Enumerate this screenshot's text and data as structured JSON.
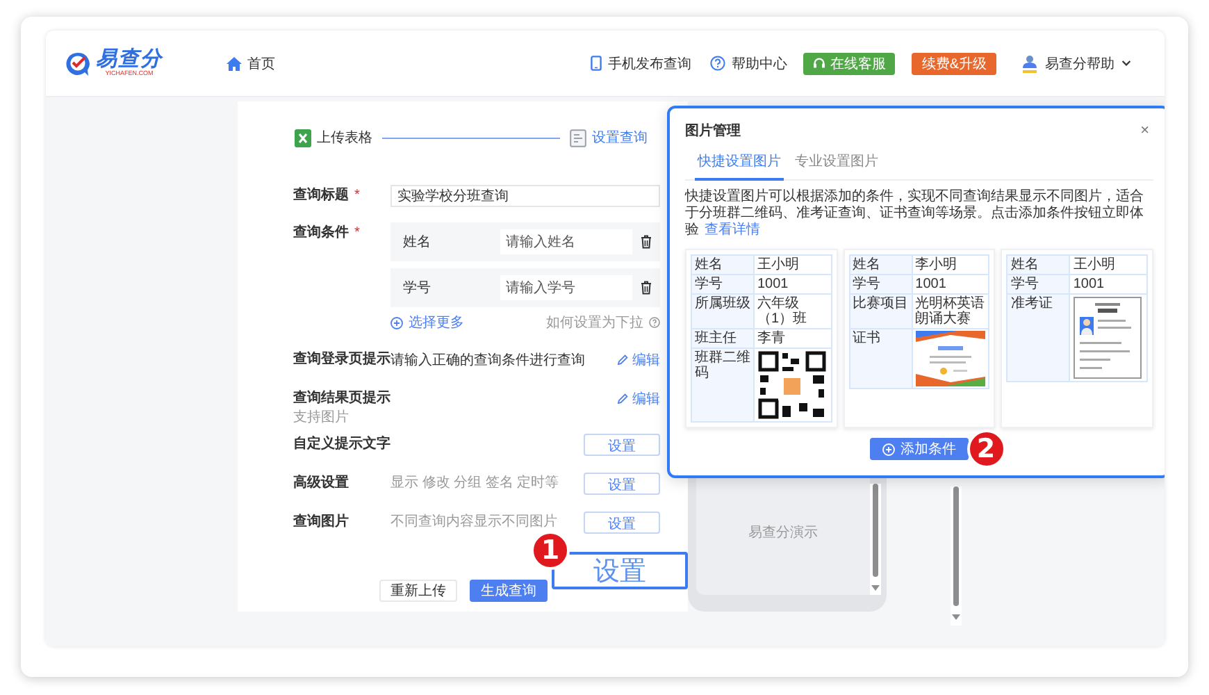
{
  "header": {
    "logo": {
      "name": "易查分",
      "domain": "YICHAFEN.COM"
    },
    "nav": [
      {
        "label": "首页"
      }
    ],
    "links": [
      {
        "kind": "phone",
        "label": "手机发布查询"
      },
      {
        "kind": "help",
        "label": "帮助中心"
      }
    ],
    "buttons": [
      {
        "kind": "service",
        "label": "在线客服"
      },
      {
        "kind": "upgrade",
        "label": "续费&升级"
      }
    ],
    "user": {
      "name": "易查分帮助"
    }
  },
  "steps": [
    {
      "kind": "excel",
      "label": "上传表格",
      "selected": false
    },
    {
      "kind": "settings",
      "label": "设置查询",
      "selected": true
    }
  ],
  "form": {
    "title_field": {
      "label": "查询标题",
      "required_mark": "*",
      "value": "实验学校分班查询"
    },
    "conditions": {
      "label": "查询条件",
      "required_mark": "*",
      "items": [
        {
          "name": "姓名",
          "placeholder": "请输入姓名"
        },
        {
          "name": "学号",
          "placeholder": "请输入学号"
        }
      ]
    },
    "more_link": "选择更多",
    "dropdown_help": "如何设置为下拉",
    "settings": [
      {
        "kind": "edit",
        "label": "查询登录页提示",
        "value": "请输入正确的查询条件进行查询",
        "action": "编辑"
      },
      {
        "kind": "edit",
        "label": "查询结果页提示",
        "sub": "支持图片",
        "action": "编辑"
      },
      {
        "kind": "button",
        "label": "自定义提示文字",
        "action": "设置"
      },
      {
        "kind": "button",
        "label": "高级设置",
        "hint": "显示 修改 分组 签名 定时等",
        "action": "设置"
      },
      {
        "kind": "button",
        "label": "查询图片",
        "hint": "不同查询内容显示不同图片",
        "action": "设置"
      }
    ],
    "buttons": [
      {
        "kind": "secondary",
        "label": "重新上传"
      },
      {
        "kind": "primary",
        "label": "生成查询"
      }
    ]
  },
  "preview": {
    "label": "易查分演示"
  },
  "callouts": [
    {
      "number": "1",
      "label": "设置"
    },
    {
      "number": "2"
    }
  ],
  "dialog": {
    "title": "图片管理",
    "close": "×",
    "tabs": [
      {
        "label": "快捷设置图片",
        "selected": true
      },
      {
        "label": "专业设置图片",
        "selected": false
      }
    ],
    "description": "快捷设置图片可以根据添加的条件，实现不同查询结果显示不同图片，适合于分班群二维码、准考证查询、证书查询等场景。点击添加条件按钮立即体验",
    "details_link": "查看详情",
    "samples": [
      {
        "rows": [
          {
            "kind": "text",
            "label": "姓名",
            "value": "王小明"
          },
          {
            "kind": "text",
            "label": "学号",
            "value": "1001"
          },
          {
            "kind": "text",
            "label": "所属班级",
            "value": "六年级（1）班"
          },
          {
            "kind": "text",
            "label": "班主任",
            "value": "李青"
          },
          {
            "kind": "picture",
            "label": "班群二维码"
          }
        ]
      },
      {
        "rows": [
          {
            "kind": "text",
            "label": "姓名",
            "value": "李小明"
          },
          {
            "kind": "text",
            "label": "学号",
            "value": "1001"
          },
          {
            "kind": "text",
            "label": "比赛项目",
            "value": "光明杯英语朗诵大赛"
          },
          {
            "kind": "picture",
            "label": "证书"
          }
        ]
      },
      {
        "rows": [
          {
            "kind": "text",
            "label": "姓名",
            "value": "王小明"
          },
          {
            "kind": "text",
            "label": "学号",
            "value": "1001"
          },
          {
            "kind": "picture",
            "label": "准考证"
          }
        ]
      }
    ],
    "add_button": "添加条件"
  }
}
